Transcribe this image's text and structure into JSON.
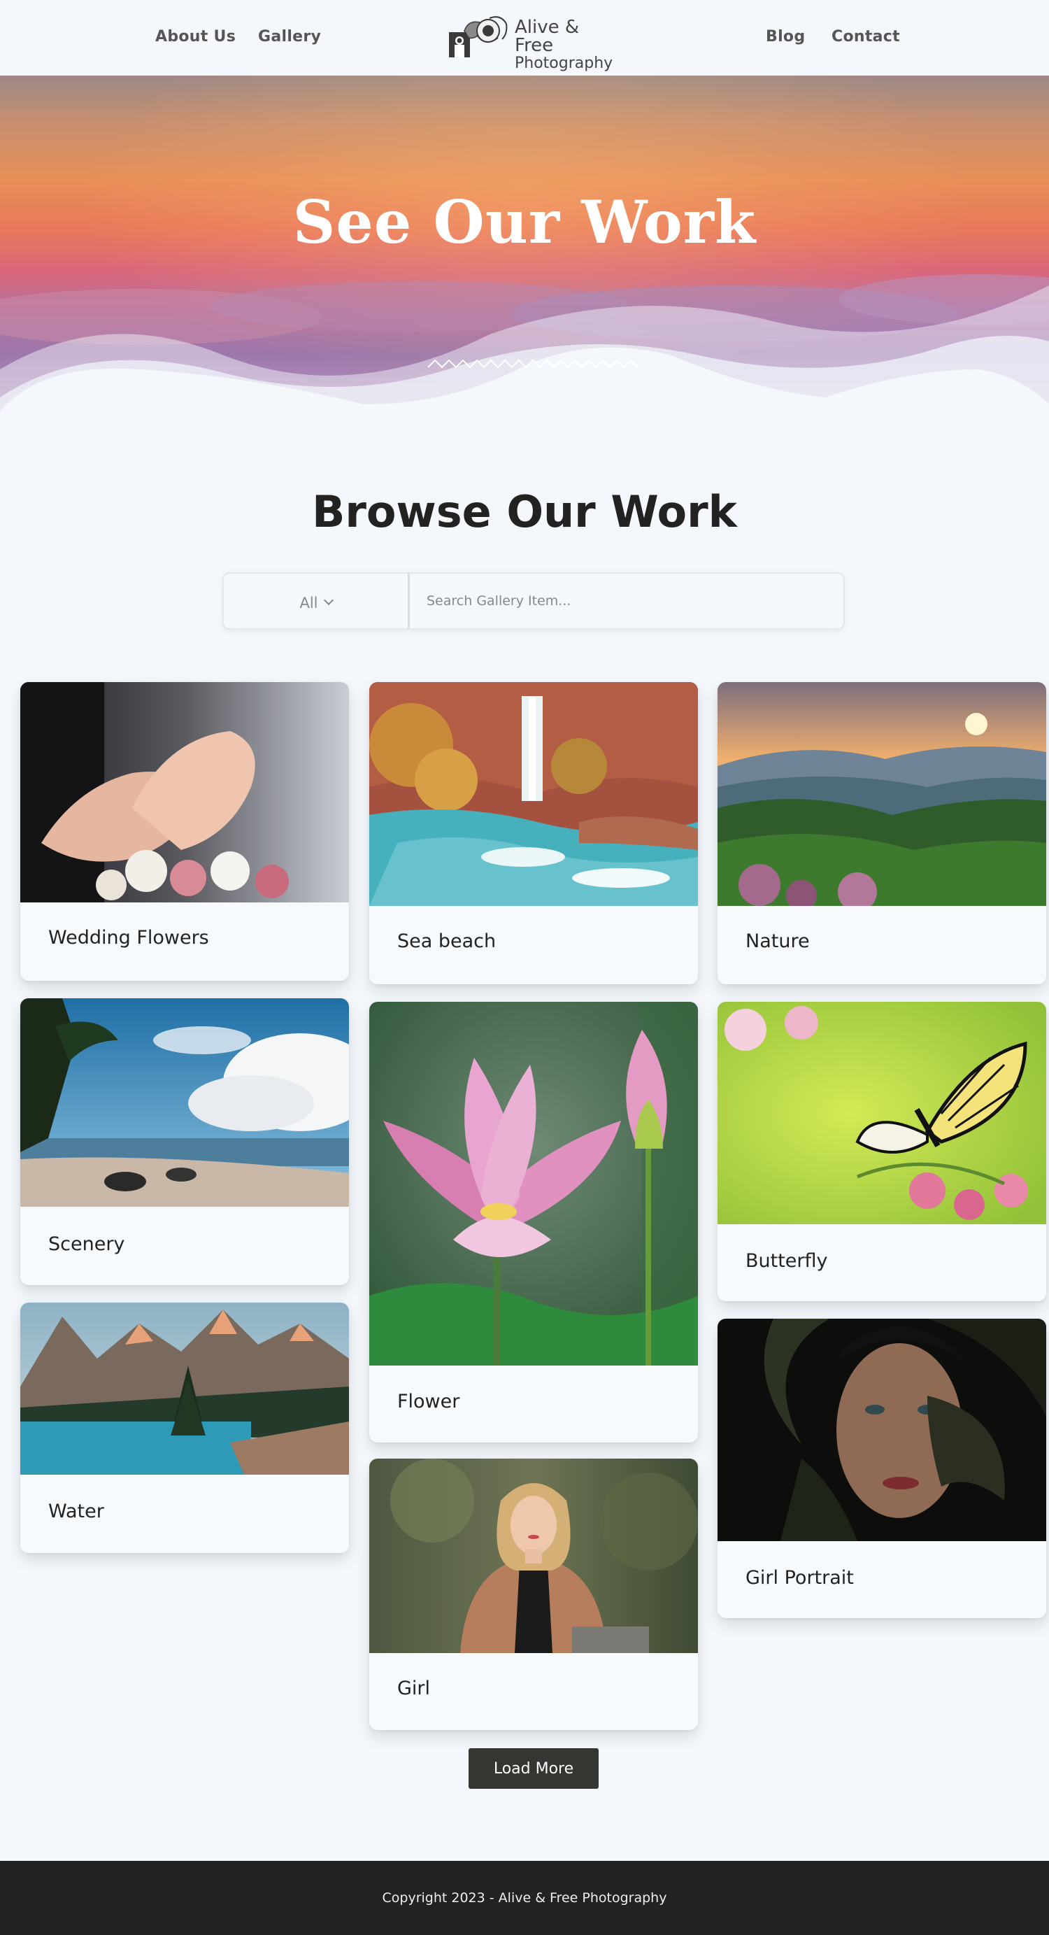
{
  "header": {
    "nav_left": [
      "About Us",
      "Gallery"
    ],
    "nav_right": [
      "Blog",
      "Contact"
    ],
    "logo_line1": "Alive & Free",
    "logo_line2": "Photography"
  },
  "hero": {
    "title": "See Our Work"
  },
  "browse": {
    "title": "Browse Our Work",
    "filter_selected": "All",
    "search_placeholder": "Search Gallery Item..."
  },
  "gallery": {
    "items": [
      "Wedding Flowers",
      "Sea beach",
      "Nature",
      "Scenery",
      "Flower",
      "Butterfly",
      "Water",
      "Girl Portrait",
      "Girl"
    ]
  },
  "load_more_label": "Load More",
  "footer": {
    "copyright": "Copyright 2023 - Alive & Free Photography"
  }
}
